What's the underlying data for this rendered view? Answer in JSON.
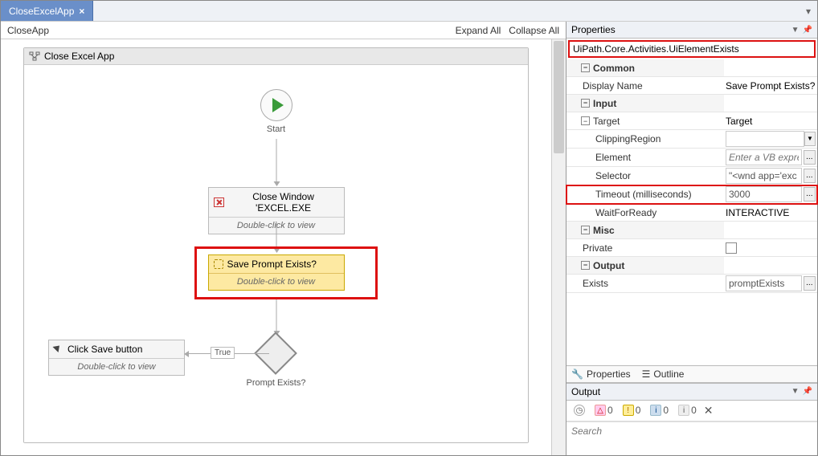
{
  "tab": {
    "title": "CloseExcelApp",
    "close": "×"
  },
  "breadcrumb": {
    "path": "CloseApp",
    "expand_all": "Expand All",
    "collapse_all": "Collapse All"
  },
  "sequence": {
    "title": "Close Excel App"
  },
  "nodes": {
    "start_label": "Start",
    "close_window": {
      "title": "Close Window 'EXCEL.EXE",
      "hint": "Double-click to view"
    },
    "save_prompt": {
      "title": "Save Prompt Exists?",
      "hint": "Double-click to view"
    },
    "click_save": {
      "title": "Click Save button",
      "hint": "Double-click to view"
    },
    "decision_label": "Prompt Exists?",
    "true_label": "True"
  },
  "properties": {
    "panel_title": "Properties",
    "type_line": "UiPath.Core.Activities.UiElementExists",
    "sections": {
      "common": "Common",
      "display_name": {
        "label": "Display Name",
        "value": "Save Prompt Exists?"
      },
      "input": "Input",
      "target": {
        "label": "Target",
        "value": "Target"
      },
      "clipping": {
        "label": "ClippingRegion",
        "value": ""
      },
      "element": {
        "label": "Element",
        "placeholder": "Enter a VB expre"
      },
      "selector": {
        "label": "Selector",
        "value": "\"<wnd app='exc"
      },
      "timeout": {
        "label": "Timeout (milliseconds)",
        "value": "3000"
      },
      "waitfor": {
        "label": "WaitForReady",
        "value": "INTERACTIVE"
      },
      "misc": "Misc",
      "private": {
        "label": "Private"
      },
      "output": "Output",
      "exists": {
        "label": "Exists",
        "value": "promptExists"
      }
    }
  },
  "bottom_tabs": {
    "properties": "Properties",
    "outline": "Outline"
  },
  "output": {
    "title": "Output",
    "search_placeholder": "Search",
    "counts": {
      "err": "0",
      "warn": "0",
      "info": "0",
      "trace": "0"
    }
  }
}
